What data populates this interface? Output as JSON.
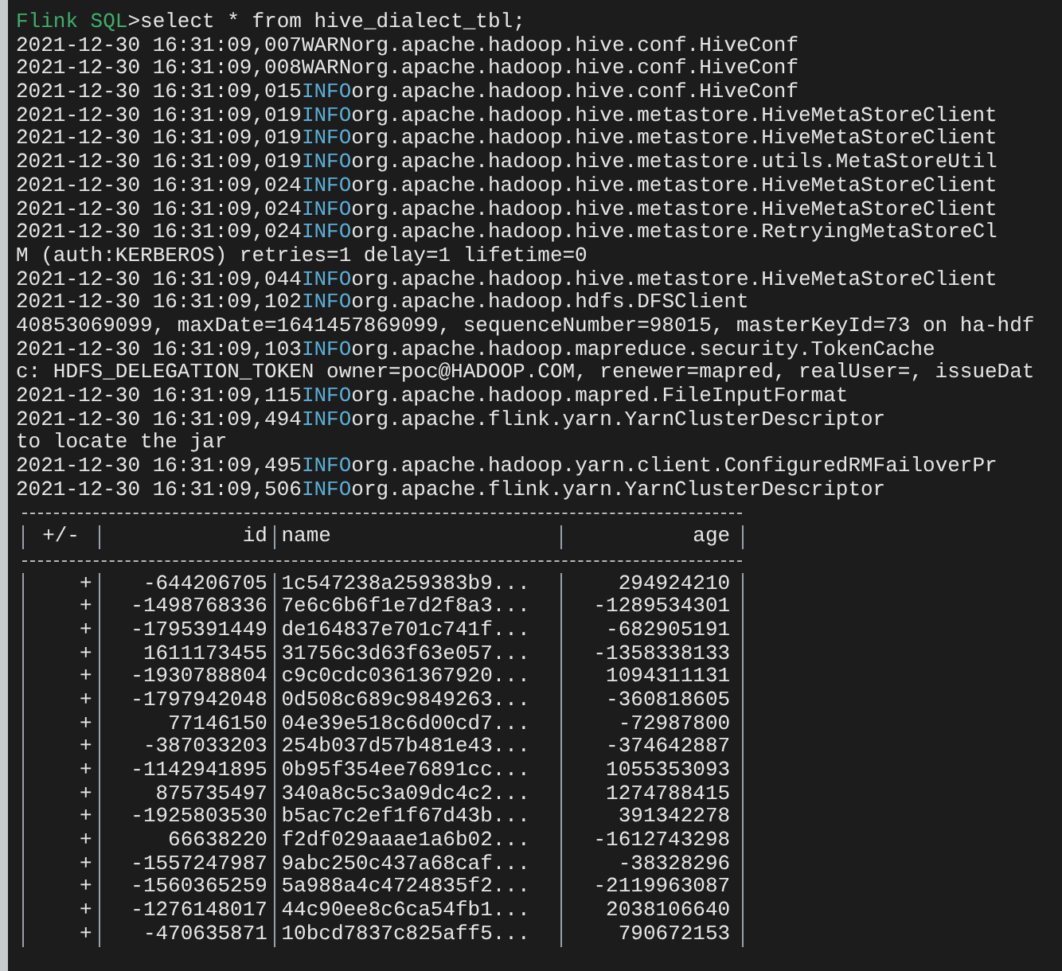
{
  "prompt": {
    "label": "Flink SQL",
    "symbol": ">",
    "command": "select * from hive_dialect_tbl;"
  },
  "log_lines": [
    {
      "kind": "warn",
      "timestamp": "2021-12-30 16:31:09,007",
      "level": "WARN",
      "logger": "org.apache.hadoop.hive.conf.HiveConf"
    },
    {
      "kind": "warn",
      "timestamp": "2021-12-30 16:31:09,008",
      "level": "WARN",
      "logger": "org.apache.hadoop.hive.conf.HiveConf"
    },
    {
      "kind": "info",
      "timestamp": "2021-12-30 16:31:09,015",
      "level": "INFO",
      "logger": "org.apache.hadoop.hive.conf.HiveConf"
    },
    {
      "kind": "info",
      "timestamp": "2021-12-30 16:31:09,019",
      "level": "INFO",
      "logger": "org.apache.hadoop.hive.metastore.HiveMetaStoreClient"
    },
    {
      "kind": "info",
      "timestamp": "2021-12-30 16:31:09,019",
      "level": "INFO",
      "logger": "org.apache.hadoop.hive.metastore.HiveMetaStoreClient"
    },
    {
      "kind": "info",
      "timestamp": "2021-12-30 16:31:09,019",
      "level": "INFO",
      "logger": "org.apache.hadoop.hive.metastore.utils.MetaStoreUtil"
    },
    {
      "kind": "info",
      "timestamp": "2021-12-30 16:31:09,024",
      "level": "INFO",
      "logger": "org.apache.hadoop.hive.metastore.HiveMetaStoreClient"
    },
    {
      "kind": "info",
      "timestamp": "2021-12-30 16:31:09,024",
      "level": "INFO",
      "logger": "org.apache.hadoop.hive.metastore.HiveMetaStoreClient"
    },
    {
      "kind": "info",
      "timestamp": "2021-12-30 16:31:09,024",
      "level": "INFO",
      "logger": "org.apache.hadoop.hive.metastore.RetryingMetaStoreCl"
    },
    {
      "kind": "text",
      "text": "M (auth:KERBEROS) retries=1 delay=1 lifetime=0"
    },
    {
      "kind": "info",
      "timestamp": "2021-12-30 16:31:09,044",
      "level": "INFO",
      "logger": "org.apache.hadoop.hive.metastore.HiveMetaStoreClient"
    },
    {
      "kind": "info",
      "timestamp": "2021-12-30 16:31:09,102",
      "level": "INFO",
      "logger": "org.apache.hadoop.hdfs.DFSClient"
    },
    {
      "kind": "text",
      "text": "40853069099, maxDate=1641457869099, sequenceNumber=98015, masterKeyId=73 on ha-hdf"
    },
    {
      "kind": "info",
      "timestamp": "2021-12-30 16:31:09,103",
      "level": "INFO",
      "logger": "org.apache.hadoop.mapreduce.security.TokenCache"
    },
    {
      "kind": "text",
      "text": "c: HDFS_DELEGATION_TOKEN owner=poc@HADOOP.COM, renewer=mapred, realUser=, issueDat"
    },
    {
      "kind": "info",
      "timestamp": "2021-12-30 16:31:09,115",
      "level": "INFO",
      "logger": "org.apache.hadoop.mapred.FileInputFormat"
    },
    {
      "kind": "info",
      "timestamp": "2021-12-30 16:31:09,494",
      "level": "INFO",
      "logger": "org.apache.flink.yarn.YarnClusterDescriptor"
    },
    {
      "kind": "text",
      "text": "to locate the jar"
    },
    {
      "kind": "info",
      "timestamp": "2021-12-30 16:31:09,495",
      "level": "INFO",
      "logger": "org.apache.hadoop.yarn.client.ConfiguredRMFailoverPr"
    },
    {
      "kind": "info",
      "timestamp": "2021-12-30 16:31:09,506",
      "level": "INFO",
      "logger": "org.apache.flink.yarn.YarnClusterDescriptor"
    }
  ],
  "table": {
    "columns": [
      "+/-",
      "id",
      "name",
      "age"
    ],
    "rows": [
      [
        "+",
        "-644206705",
        "1c547238a259383b9...",
        "294924210"
      ],
      [
        "+",
        "-1498768336",
        "7e6c6b6f1e7d2f8a3...",
        "-1289534301"
      ],
      [
        "+",
        "-1795391449",
        "de164837e701c741f...",
        "-682905191"
      ],
      [
        "+",
        "1611173455",
        "31756c3d63f63e057...",
        "-1358338133"
      ],
      [
        "+",
        "-1930788804",
        "c9c0cdc0361367920...",
        "1094311131"
      ],
      [
        "+",
        "-1797942048",
        "0d508c689c9849263...",
        "-360818605"
      ],
      [
        "+",
        "77146150",
        "04e39e518c6d00cd7...",
        "-72987800"
      ],
      [
        "+",
        "-387033203",
        "254b037d57b481e43...",
        "-374642887"
      ],
      [
        "+",
        "-1142941895",
        "0b95f354ee76891cc...",
        "1055353093"
      ],
      [
        "+",
        "875735497",
        "340a8c5c3a09dc4c2...",
        "1274788415"
      ],
      [
        "+",
        "-1925803530",
        "b5ac7c2ef1f67d43b...",
        "391342278"
      ],
      [
        "+",
        "66638220",
        "f2df029aaae1a6b02...",
        "-1612743298"
      ],
      [
        "+",
        "-1557247987",
        "9abc250c437a68caf...",
        "-38328296"
      ],
      [
        "+",
        "-1560365259",
        "5a988a4c4724835f2...",
        "-2119963087"
      ],
      [
        "+",
        "-1276148017",
        "44c90ee8c6ca54fb1...",
        "2038106640"
      ],
      [
        "+",
        "-470635871",
        "10bcd7837c825aff5...",
        "790672153"
      ]
    ]
  }
}
